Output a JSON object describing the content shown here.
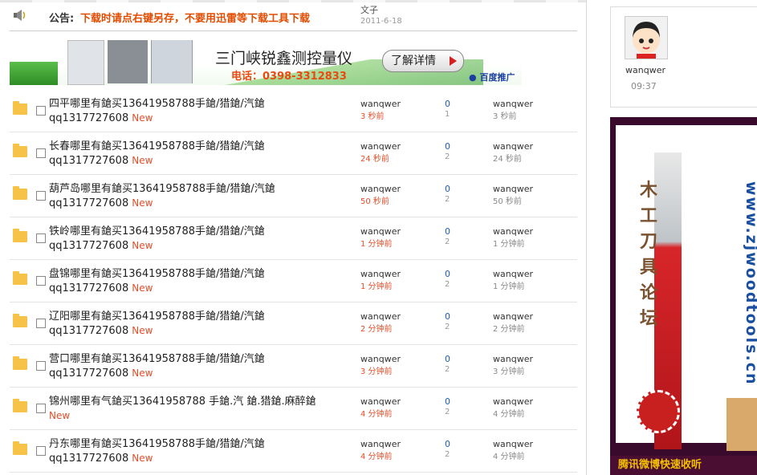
{
  "notice": {
    "label": "公告:",
    "text": "下载时请点右键另存，不要用迅雷等下载工具下载",
    "author": "文子",
    "date": "2011-6-18"
  },
  "banner": {
    "title": "三门峡锐鑫测控量仪",
    "phone": "电话：0398-3312833",
    "button": "了解详情",
    "badge": "百度推广"
  },
  "threads": [
    {
      "title": "四平哪里有鎗买13641958788手鎗/猎鎗/汽鎗",
      "line2": "qq1317727608",
      "badge": "New",
      "author": "wanqwer",
      "posted": "3 秒前",
      "replies": "0",
      "views": "1",
      "last_user": "wanqwer",
      "last_time": "3 秒前"
    },
    {
      "title": "长春哪里有鎗买13641958788手鎗/猎鎗/汽鎗",
      "line2": "qq1317727608",
      "badge": "New",
      "author": "wanqwer",
      "posted": "24 秒前",
      "replies": "0",
      "views": "2",
      "last_user": "wanqwer",
      "last_time": "24 秒前"
    },
    {
      "title": "葫芦岛哪里有鎗买13641958788手鎗/猎鎗/汽鎗",
      "line2": "qq1317727608",
      "badge": "New",
      "author": "wanqwer",
      "posted": "50 秒前",
      "replies": "0",
      "views": "2",
      "last_user": "wanqwer",
      "last_time": "50 秒前"
    },
    {
      "title": "铁岭哪里有鎗买13641958788手鎗/猎鎗/汽鎗",
      "line2": "qq1317727608",
      "badge": "New",
      "author": "wanqwer",
      "posted": "1 分钟前",
      "replies": "0",
      "views": "2",
      "last_user": "wanqwer",
      "last_time": "1 分钟前"
    },
    {
      "title": "盘锦哪里有鎗买13641958788手鎗/猎鎗/汽鎗",
      "line2": "qq1317727608",
      "badge": "New",
      "author": "wanqwer",
      "posted": "1 分钟前",
      "replies": "0",
      "views": "2",
      "last_user": "wanqwer",
      "last_time": "1 分钟前"
    },
    {
      "title": "辽阳哪里有鎗买13641958788手鎗/猎鎗/汽鎗",
      "line2": "qq1317727608",
      "badge": "New",
      "author": "wanqwer",
      "posted": "2 分钟前",
      "replies": "0",
      "views": "2",
      "last_user": "wanqwer",
      "last_time": "2 分钟前"
    },
    {
      "title": "营口哪里有鎗买13641958788手鎗/猎鎗/汽鎗",
      "line2": "qq1317727608",
      "badge": "New",
      "author": "wanqwer",
      "posted": "3 分钟前",
      "replies": "0",
      "views": "2",
      "last_user": "wanqwer",
      "last_time": "3 分钟前"
    },
    {
      "title": "锦州哪里有气鎗买13641958788 手鎗.汽 鎗.猎鎗.麻醉鎗",
      "line2": "",
      "badge": "New",
      "author": "wanqwer",
      "posted": "4 分钟前",
      "replies": "0",
      "views": "2",
      "last_user": "wanqwer",
      "last_time": "4 分钟前"
    },
    {
      "title": "丹东哪里有鎗买13641958788手鎗/猎鎗/汽鎗",
      "line2": "qq1317727608",
      "badge": "New",
      "author": "wanqwer",
      "posted": "4 分钟前",
      "replies": "0",
      "views": "2",
      "last_user": "wanqwer",
      "last_time": "4 分钟前"
    }
  ],
  "sidebar": {
    "username": "wanqwer",
    "time": "09:37",
    "ad_vertical_text": "木工刀具论坛",
    "ad_url": "www.zjwoodtools.cn",
    "ad_bottom": "腾讯微博快速收听"
  },
  "icons": {
    "notice": "speaker-icon",
    "thread": "folder-icon",
    "banner_button": "play-arrow-icon",
    "badge": "paw-icon"
  },
  "colors": {
    "notice_text": "#e04c00",
    "new_badge": "#e34e2a",
    "reply_count": "#1a5fb4",
    "ad_background": "#3a0a2c",
    "ad_bar_text": "#f6c000"
  }
}
